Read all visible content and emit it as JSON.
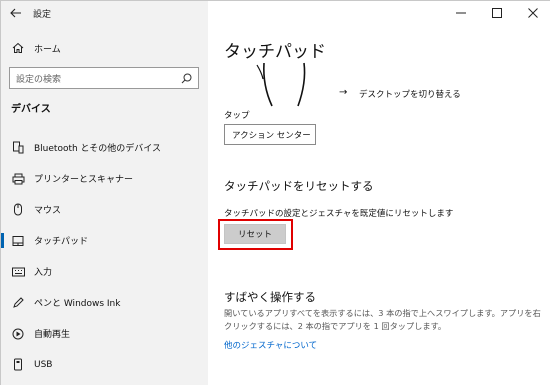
{
  "window": {
    "title": "設定"
  },
  "sidebar": {
    "home_label": "ホーム",
    "search_placeholder": "設定の検索",
    "section_title": "デバイス",
    "items": [
      {
        "label": "Bluetooth とその他のデバイス",
        "icon": "bluetooth-devices-icon"
      },
      {
        "label": "プリンターとスキャナー",
        "icon": "printer-icon"
      },
      {
        "label": "マウス",
        "icon": "mouse-icon"
      },
      {
        "label": "タッチパッド",
        "icon": "touchpad-icon",
        "selected": true
      },
      {
        "label": "入力",
        "icon": "keyboard-icon"
      },
      {
        "label": "ペンと Windows Ink",
        "icon": "pen-icon"
      },
      {
        "label": "自動再生",
        "icon": "autoplay-icon"
      },
      {
        "label": "USB",
        "icon": "usb-icon"
      }
    ]
  },
  "main": {
    "page_title": "タッチパッド",
    "gesture_arrow": "→",
    "gesture_action": "デスクトップを切り替える",
    "tap_label": "タップ",
    "tap_value": "アクション センター",
    "reset_heading": "タッチパッドをリセットする",
    "reset_description": "タッチパッドの設定とジェスチャを既定値にリセットします",
    "reset_button": "リセット",
    "quick_heading": "すばやく操作する",
    "quick_description": "開いているアプリすべてを表示するには、3 本の指で上へスワイプします。アプリを右クリックするには、2 本の指でアプリを 1 回タップします。",
    "gesture_link": "他のジェスチャについて"
  },
  "colors": {
    "sidebar_bg": "#f2f2f2",
    "accent": "#0063b1",
    "highlight": "#e00000",
    "link": "#0066cc"
  }
}
